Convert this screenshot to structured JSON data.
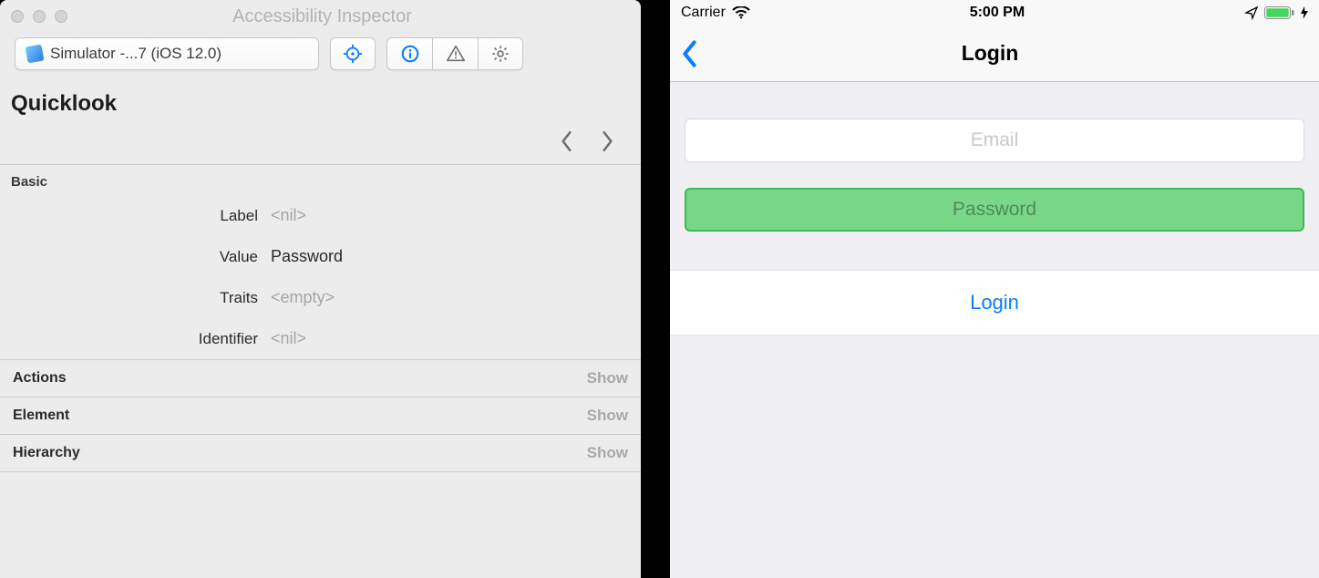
{
  "inspector": {
    "window_title": "Accessibility Inspector",
    "target_label": "Simulator -...7 (iOS 12.0)",
    "quicklook_title": "Quicklook",
    "basic_header": "Basic",
    "fields": {
      "label_k": "Label",
      "label_v": "<nil>",
      "value_k": "Value",
      "value_v": "Password",
      "traits_k": "Traits",
      "traits_v": "<empty>",
      "identifier_k": "Identifier",
      "identifier_v": "<nil>"
    },
    "sections": {
      "actions": "Actions",
      "element": "Element",
      "hierarchy": "Hierarchy",
      "show": "Show"
    }
  },
  "ios": {
    "status": {
      "carrier": "Carrier",
      "time": "5:00 PM"
    },
    "nav_title": "Login",
    "email_placeholder": "Email",
    "password_placeholder": "Password",
    "login_button": "Login"
  }
}
